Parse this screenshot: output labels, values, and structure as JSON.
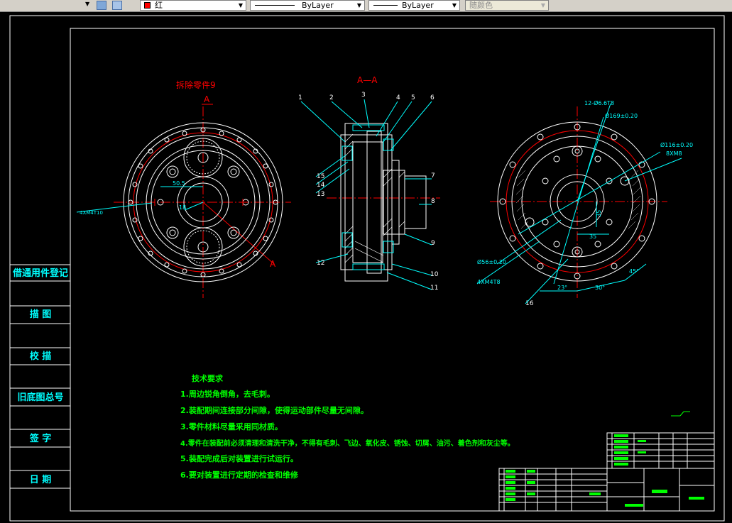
{
  "toolbar": {
    "color_value": "红",
    "linetype_value": "ByLayer",
    "lineweight_value": "ByLayer",
    "plotstyle_value": "随颜色"
  },
  "side_table": {
    "row1": "借通用件登记",
    "row2": "描 图",
    "row3": "校 描",
    "row4": "旧底图总号",
    "row5": "签 字",
    "row6": "日 期"
  },
  "drawing": {
    "remove_part_note": "拆除零件9",
    "section_mark_a": "A",
    "section_title": "A—A",
    "callouts": [
      "1",
      "2",
      "3",
      "4",
      "5",
      "6",
      "7",
      "8",
      "9",
      "10",
      "11",
      "12",
      "13",
      "14",
      "15",
      "16"
    ],
    "left_dim_50_5": "50.5",
    "left_dim_r": "18",
    "left_hole_note": "4XM4T10",
    "right_dims": {
      "holes_12": "12-Ø6.6T8",
      "d169": "Ø169±0.20",
      "d116": "Ø116±0.20",
      "m8": "8XM8",
      "d56": "Ø56±0.20",
      "m4": "4XM4T8",
      "v35a": "35",
      "h35": "35",
      "ang23": "23°",
      "ang30": "30°",
      "ang45": "45°"
    }
  },
  "technical_requirements": {
    "title": "技术要求",
    "items": [
      "1.周边锐角倒角，去毛刺。",
      "2.装配期间连接部分间隙，使得运动部件尽量无间隙。",
      "3.零件材料尽量采用同材质。",
      "4.零件在装配前必须清理和清洗干净，不得有毛刺、飞边、氧化皮、锈蚀、切屑、油污、着色剂和灰尘等。",
      "5.装配完成后对装置进行试运行。",
      "6.要对装置进行定期的检查和维修"
    ]
  },
  "colors": {
    "background": "#000000",
    "frame": "#ffffff",
    "red": "#ff0000",
    "cyan": "#00ffff",
    "green": "#00ff00",
    "yellow": "#ffff00"
  }
}
